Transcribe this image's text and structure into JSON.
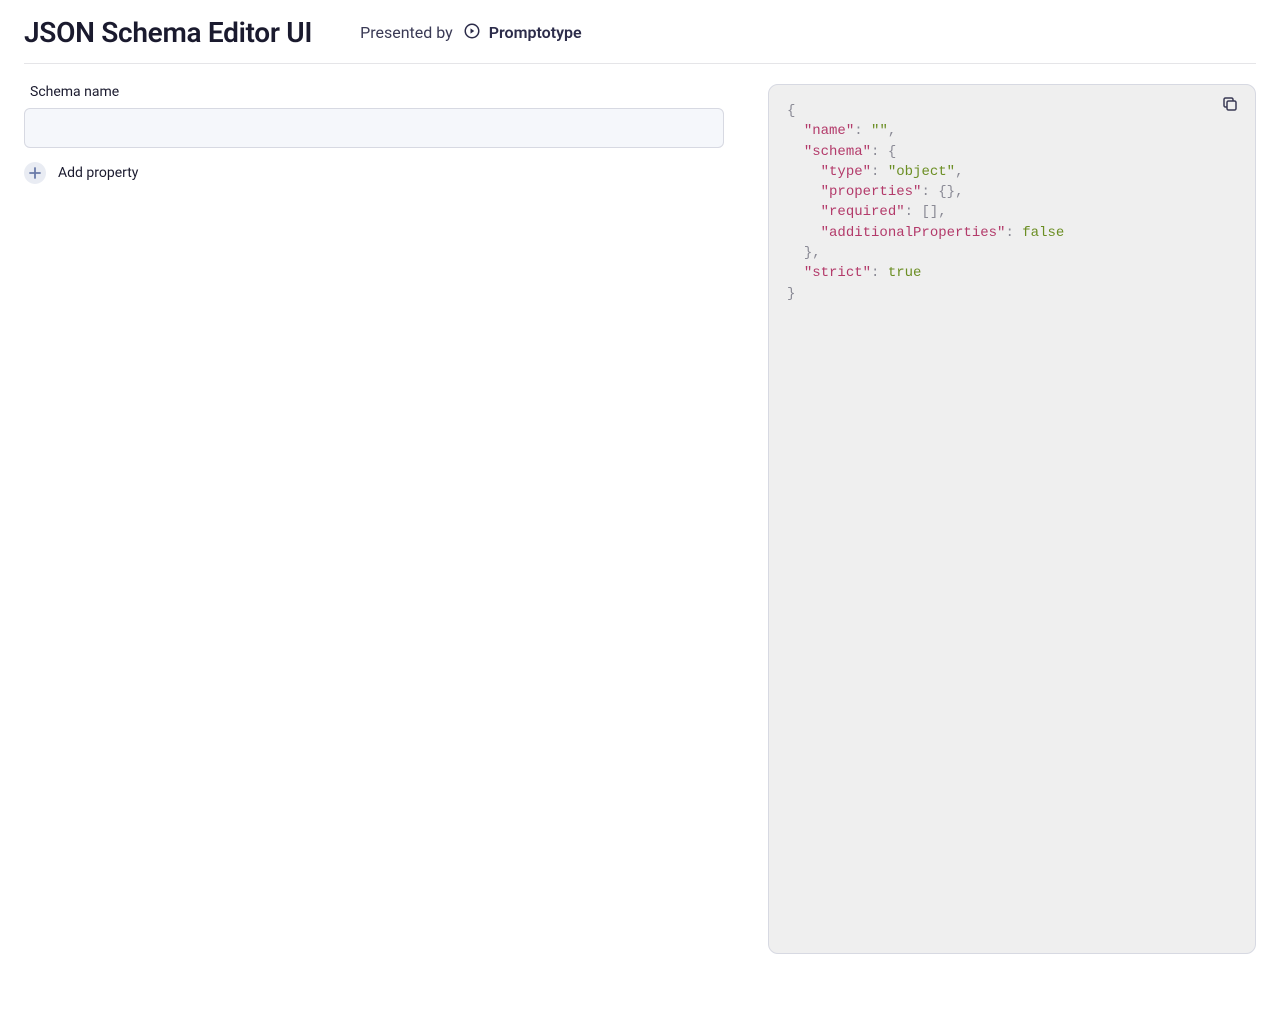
{
  "header": {
    "title": "JSON Schema Editor UI",
    "presented_by": "Presented by",
    "brand": "Promptotype"
  },
  "form": {
    "schema_name_label": "Schema name",
    "schema_name_value": "",
    "add_property_label": "Add property"
  },
  "code": {
    "tokens": {
      "l1": "{",
      "l2_key": "\"name\"",
      "l2_val": "\"\"",
      "l3_key": "\"schema\"",
      "l3_brace": "{",
      "l4_key": "\"type\"",
      "l4_val": "\"object\"",
      "l5_key": "\"properties\"",
      "l5_val": "{}",
      "l6_key": "\"required\"",
      "l6_val": "[]",
      "l7_key": "\"additionalProperties\"",
      "l7_val": "false",
      "l8_close": "}",
      "l9_key": "\"strict\"",
      "l9_val": "true",
      "l10": "}"
    }
  }
}
